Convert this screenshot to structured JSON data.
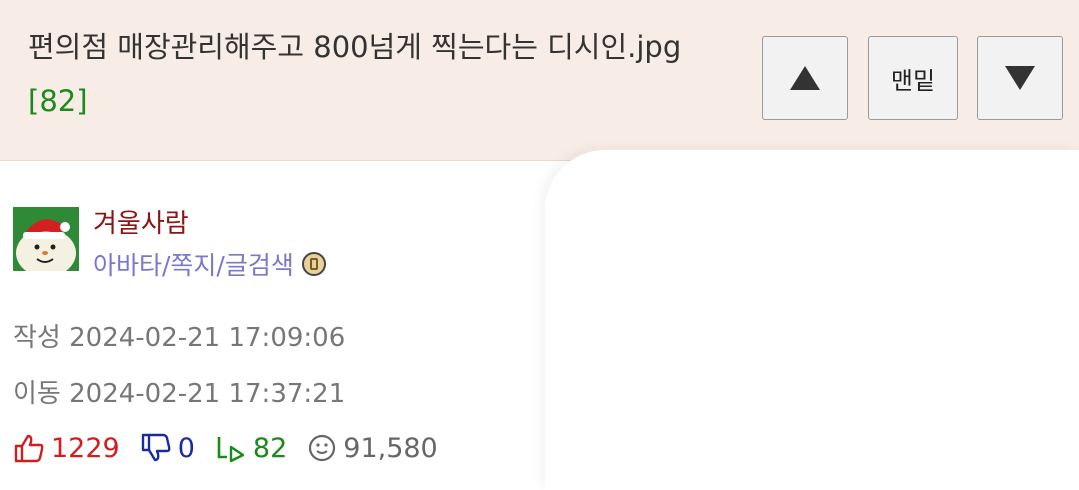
{
  "post": {
    "title": "편의점 매장관리해주고 800넘게 찍는다는 디시인.jpg",
    "comment_count": "[82]"
  },
  "nav": {
    "up_icon": "triangle-up-icon",
    "bottom_label": "맨밑",
    "down_icon": "triangle-down-icon"
  },
  "author": {
    "name": "겨울사람",
    "links": "아바타/쪽지/글검색",
    "avatar_icon": "snowman-santa-hat-avatar",
    "badge_icon": "member-badge-icon"
  },
  "meta": {
    "created": "작성 2024-02-21 17:09:06",
    "moved": "이동 2024-02-21 17:37:21"
  },
  "stats": {
    "likes": "1229",
    "dislikes": "0",
    "replies": "82",
    "views": "91,580"
  },
  "colors": {
    "header_bg": "#f8ede6",
    "likes": "#d31d1d",
    "dislikes": "#1a2aa0",
    "replies": "#1a8a1a",
    "author_name": "#8b1414",
    "author_links": "#7a78cc"
  }
}
